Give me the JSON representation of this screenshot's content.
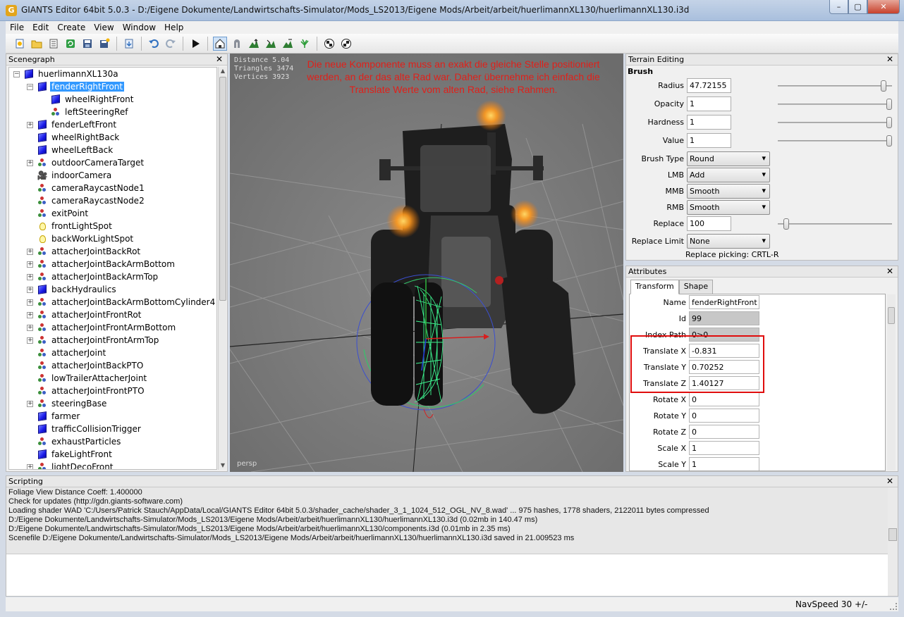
{
  "window": {
    "app_icon": "G",
    "title": "GIANTS Editor 64bit 5.0.3 - D:/Eigene Dokumente/Landwirtschafts-Simulator/Mods_LS2013/Eigene Mods/Arbeit/arbeit/huerlimannXL130/huerlimannXL130.i3d",
    "minimize": "–",
    "maximize": "▢",
    "close": "✕"
  },
  "menu": [
    "File",
    "Edit",
    "Create",
    "View",
    "Window",
    "Help"
  ],
  "toolbar_icons": [
    "new-icon",
    "open-icon",
    "list-icon",
    "refresh-icon",
    "save-icon",
    "save-as-icon",
    "import-icon",
    "undo-icon",
    "redo-icon",
    "play-icon",
    "select-tool-icon",
    "move-tool-icon",
    "terrain-sculpt-icon",
    "terrain-paint-icon",
    "terrain-smooth-icon",
    "foliage-paint-icon",
    "checker-icon",
    "checker-alt-icon"
  ],
  "scenegraph": {
    "title": "Scenegraph",
    "nodes": [
      {
        "label": "huerlimannXL130a",
        "icon": "cube",
        "depth": 0,
        "exp": "-"
      },
      {
        "label": "fenderRightFront",
        "icon": "cube",
        "depth": 1,
        "exp": "-",
        "selected": true
      },
      {
        "label": "wheelRightFront",
        "icon": "cube",
        "depth": 2,
        "exp": ""
      },
      {
        "label": "leftSteeringRef",
        "icon": "tg",
        "depth": 2,
        "exp": ""
      },
      {
        "label": "fenderLeftFront",
        "icon": "cube",
        "depth": 1,
        "exp": "+"
      },
      {
        "label": "wheelRightBack",
        "icon": "cube",
        "depth": 1,
        "exp": ""
      },
      {
        "label": "wheelLeftBack",
        "icon": "cube",
        "depth": 1,
        "exp": ""
      },
      {
        "label": "outdoorCameraTarget",
        "icon": "tg",
        "depth": 1,
        "exp": "+"
      },
      {
        "label": "indoorCamera",
        "icon": "cam",
        "depth": 1,
        "exp": ""
      },
      {
        "label": "cameraRaycastNode1",
        "icon": "tg",
        "depth": 1,
        "exp": ""
      },
      {
        "label": "cameraRaycastNode2",
        "icon": "tg",
        "depth": 1,
        "exp": ""
      },
      {
        "label": "exitPoint",
        "icon": "tg",
        "depth": 1,
        "exp": ""
      },
      {
        "label": "frontLightSpot",
        "icon": "bulb",
        "depth": 1,
        "exp": ""
      },
      {
        "label": "backWorkLightSpot",
        "icon": "bulb",
        "depth": 1,
        "exp": ""
      },
      {
        "label": "attacherJointBackRot",
        "icon": "tg",
        "depth": 1,
        "exp": "+"
      },
      {
        "label": "attacherJointBackArmBottom",
        "icon": "tg",
        "depth": 1,
        "exp": "+"
      },
      {
        "label": "attacherJointBackArmTop",
        "icon": "tg",
        "depth": 1,
        "exp": "+"
      },
      {
        "label": "backHydraulics",
        "icon": "cube",
        "depth": 1,
        "exp": "+"
      },
      {
        "label": "attacherJointBackArmBottomCylinder4",
        "icon": "tg",
        "depth": 1,
        "exp": "+"
      },
      {
        "label": "attacherJointFrontRot",
        "icon": "tg",
        "depth": 1,
        "exp": "+"
      },
      {
        "label": "attacherJointFrontArmBottom",
        "icon": "tg",
        "depth": 1,
        "exp": "+"
      },
      {
        "label": "attacherJointFrontArmTop",
        "icon": "tg",
        "depth": 1,
        "exp": "+"
      },
      {
        "label": "attacherJoint",
        "icon": "tg",
        "depth": 1,
        "exp": ""
      },
      {
        "label": "attacherJointBackPTO",
        "icon": "tg",
        "depth": 1,
        "exp": ""
      },
      {
        "label": "lowTrailerAttacherJoint",
        "icon": "tg",
        "depth": 1,
        "exp": ""
      },
      {
        "label": "attacherJointFrontPTO",
        "icon": "tg",
        "depth": 1,
        "exp": ""
      },
      {
        "label": "steeringBase",
        "icon": "tg",
        "depth": 1,
        "exp": "+"
      },
      {
        "label": "farmer",
        "icon": "cube",
        "depth": 1,
        "exp": ""
      },
      {
        "label": "trafficCollisionTrigger",
        "icon": "cube",
        "depth": 1,
        "exp": ""
      },
      {
        "label": "exhaustParticles",
        "icon": "tg",
        "depth": 1,
        "exp": ""
      },
      {
        "label": "fakeLightFront",
        "icon": "cube",
        "depth": 1,
        "exp": ""
      },
      {
        "label": "lightDecoFront",
        "icon": "tg",
        "depth": 1,
        "exp": "+"
      }
    ]
  },
  "viewport": {
    "stats": [
      "Distance 5.04",
      "Triangles 3474",
      "Vertices 3923"
    ],
    "annotation": "Die neue Komponente muss an exakt die gleiche Stelle positioniert werden, an der das alte Rad war. Daher übernehme ich einfach die Translate Werte vom alten Rad, siehe Rahmen.",
    "camera_label": "persp"
  },
  "terrain": {
    "title": "Terrain Editing",
    "brush_title": "Brush",
    "radius": {
      "label": "Radius",
      "value": "47.72155",
      "level": 0.95
    },
    "opacity": {
      "label": "Opacity",
      "value": "1",
      "level": 1.0
    },
    "hardness": {
      "label": "Hardness",
      "value": "1",
      "level": 1.0
    },
    "value": {
      "label": "Value",
      "value": "1",
      "level": 1.0
    },
    "brush_type": {
      "label": "Brush Type",
      "value": "Round"
    },
    "lmb": {
      "label": "LMB",
      "value": "Add"
    },
    "mmb": {
      "label": "MMB",
      "value": "Smooth"
    },
    "rmb": {
      "label": "RMB",
      "value": "Smooth"
    },
    "replace": {
      "label": "Replace",
      "value": "100",
      "level": 0.05
    },
    "replace_limit": {
      "label": "Replace Limit",
      "value": "None"
    },
    "hint": "Replace picking: CRTL-R"
  },
  "attributes": {
    "title": "Attributes",
    "tabs": [
      "Transform",
      "Shape"
    ],
    "rows": [
      {
        "label": "Name",
        "value": "fenderRightFront",
        "ro": false
      },
      {
        "label": "Id",
        "value": "99",
        "ro": true
      },
      {
        "label": "Index Path",
        "value": "0>0",
        "ro": true
      },
      {
        "label": "Translate X",
        "value": "-0.831",
        "ro": false
      },
      {
        "label": "Translate Y",
        "value": "0.70252",
        "ro": false
      },
      {
        "label": "Translate Z",
        "value": "1.40127",
        "ro": false
      },
      {
        "label": "Rotate X",
        "value": "0",
        "ro": false
      },
      {
        "label": "Rotate Y",
        "value": "0",
        "ro": false
      },
      {
        "label": "Rotate Z",
        "value": "0",
        "ro": false
      },
      {
        "label": "Scale X",
        "value": "1",
        "ro": false
      },
      {
        "label": "Scale Y",
        "value": "1",
        "ro": false
      }
    ]
  },
  "scripting": {
    "title": "Scripting",
    "lines": [
      "  Foliage View Distance Coeff: 1.400000",
      "Check for updates (http://gdn.giants-software.com)",
      "Loading shader WAD 'C:/Users/Patrick Stauch/AppData/Local/GIANTS Editor 64bit 5.0.3/shader_cache/shader_3_1_1024_512_OGL_NV_8.wad' ... 975 hashes, 1778 shaders, 2122011 bytes compressed",
      "D:/Eigene Dokumente/Landwirtschafts-Simulator/Mods_LS2013/Eigene Mods/Arbeit/arbeit/huerlimannXL130/huerlimannXL130.i3d (0.02mb in 140.47 ms)",
      "D:/Eigene Dokumente/Landwirtschafts-Simulator/Mods_LS2013/Eigene Mods/Arbeit/arbeit/huerlimannXL130/components.i3d (0.01mb in 2.35 ms)",
      "Scenefile D:/Eigene Dokumente/Landwirtschafts-Simulator/Mods_LS2013/Eigene Mods/Arbeit/arbeit/huerlimannXL130/huerlimannXL130.i3d saved in 21.009523 ms"
    ]
  },
  "status": {
    "navspeed": "NavSpeed 30 +/-"
  },
  "colors": {
    "selection": "#3399ff",
    "annotation": "#e0201a",
    "highlight_box": "#e00d0d"
  }
}
